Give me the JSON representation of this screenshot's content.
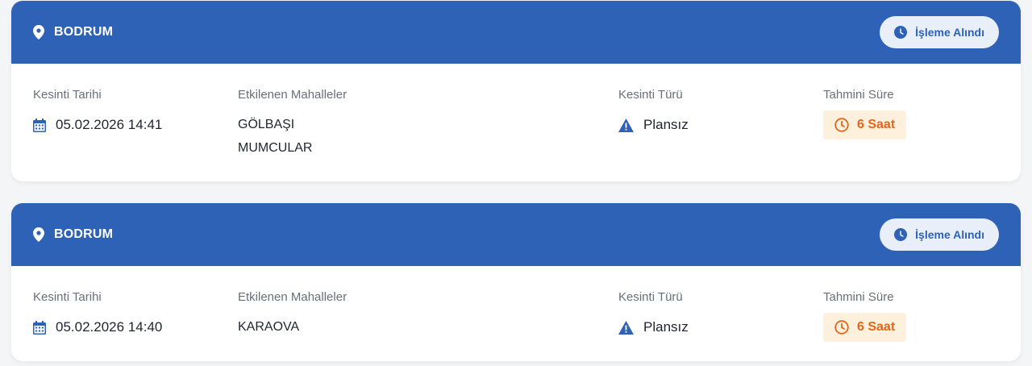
{
  "colors": {
    "header_bg": "#2d62b6",
    "badge_bg": "#e9eff9",
    "duration_bg": "#fdf0dc",
    "duration_text": "#e0661d"
  },
  "outages": [
    {
      "location": "BODRUM",
      "status": "İşleme Alındı",
      "date_label": "Kesinti Tarihi",
      "date": "05.02.2026 14:41",
      "neighborhoods_label": "Etkilenen Mahalleler",
      "neighborhoods": [
        "GÖLBAŞI",
        "MUMCULAR"
      ],
      "type_label": "Kesinti Türü",
      "type": "Plansız",
      "duration_label": "Tahmini Süre",
      "duration": "6 Saat"
    },
    {
      "location": "BODRUM",
      "status": "İşleme Alındı",
      "date_label": "Kesinti Tarihi",
      "date": "05.02.2026 14:40",
      "neighborhoods_label": "Etkilenen Mahalleler",
      "neighborhoods": [
        "KARAOVA"
      ],
      "type_label": "Kesinti Türü",
      "type": "Plansız",
      "duration_label": "Tahmini Süre",
      "duration": "6 Saat"
    }
  ],
  "icons": {
    "location": "map-pin-icon",
    "status": "clock-icon",
    "date": "calendar-icon",
    "type": "warning-triangle-icon",
    "duration": "clock-outline-icon"
  }
}
